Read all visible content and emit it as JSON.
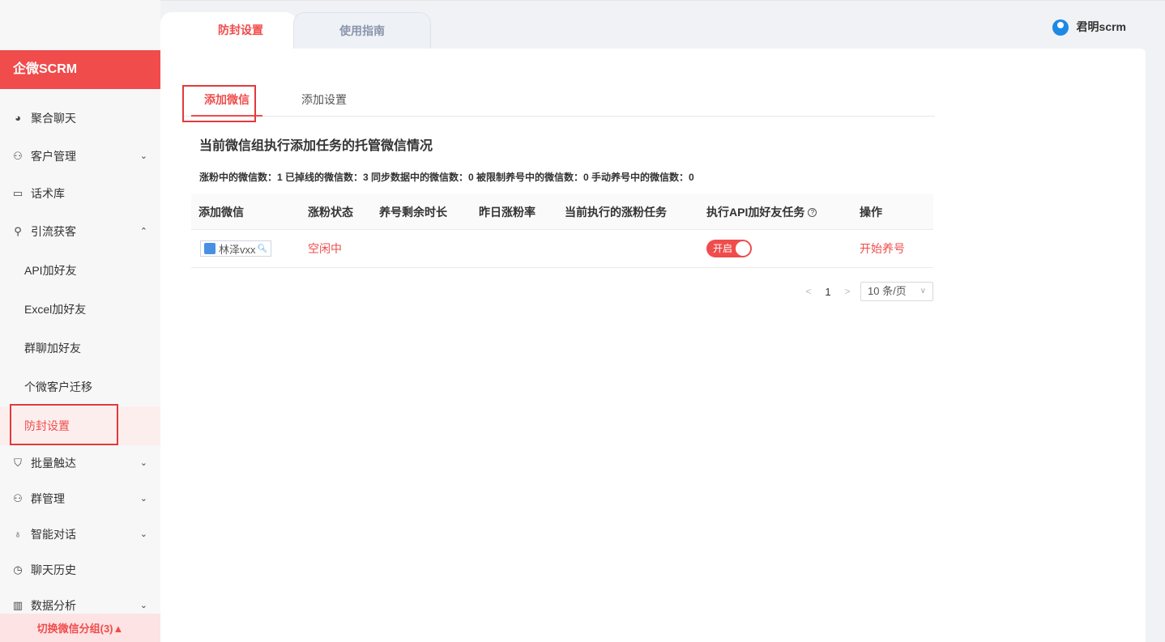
{
  "brand": {
    "name": "企微SCRM"
  },
  "topbar": {
    "tabs": [
      {
        "label": "防封设置",
        "active": true
      },
      {
        "label": "使用指南",
        "active": false
      }
    ],
    "user": {
      "name": "君明scrm"
    }
  },
  "sidebar": {
    "items": [
      {
        "label": "聚合聊天",
        "icon": "wechat-icon"
      },
      {
        "label": "客户管理",
        "icon": "users-icon",
        "chevron": "down"
      },
      {
        "label": "话术库",
        "icon": "folder-icon"
      },
      {
        "label": "引流获客",
        "icon": "user-icon",
        "chevron": "up"
      }
    ],
    "sub_items": [
      {
        "label": "API加好友"
      },
      {
        "label": "Excel加好友"
      },
      {
        "label": "群聊加好友"
      },
      {
        "label": "个微客户迁移"
      },
      {
        "label": "防封设置",
        "active": true
      }
    ],
    "items_after": [
      {
        "label": "批量触达",
        "icon": "funnel-icon",
        "chevron": "down"
      },
      {
        "label": "群管理",
        "icon": "group-icon",
        "chevron": "down"
      },
      {
        "label": "智能对话",
        "icon": "bulb-icon",
        "chevron": "down"
      },
      {
        "label": "聊天历史",
        "icon": "clock-icon"
      },
      {
        "label": "数据分析",
        "icon": "chart-icon",
        "chevron": "down"
      }
    ],
    "bottom_switch": "切换微信分组(3)▲"
  },
  "main": {
    "tabs": [
      {
        "label": "添加微信",
        "active": true
      },
      {
        "label": "添加设置",
        "active": false
      }
    ],
    "section_title": "当前微信组执行添加任务的托管微信情况",
    "stats": "涨粉中的微信数：1 已掉线的微信数：3 同步数据中的微信数：0 被限制养号中的微信数：0 手动养号中的微信数：0",
    "table": {
      "headers": [
        "添加微信",
        "涨粉状态",
        "养号剩余时长",
        "昨日涨粉率",
        "当前执行的涨粉任务",
        "执行API加好友任务",
        "操作"
      ],
      "rows": [
        {
          "wechat": "林泽vxx",
          "status": "空闲中",
          "remaining": "",
          "yesterday_rate": "",
          "current_task": "",
          "api_switch": "开启",
          "action": "开始养号"
        }
      ]
    },
    "pagination": {
      "prev": "<",
      "page": "1",
      "next": ">",
      "page_size": "10 条/页"
    }
  },
  "colors": {
    "accent": "#f04c4c",
    "avatar": "#1e88e5"
  }
}
